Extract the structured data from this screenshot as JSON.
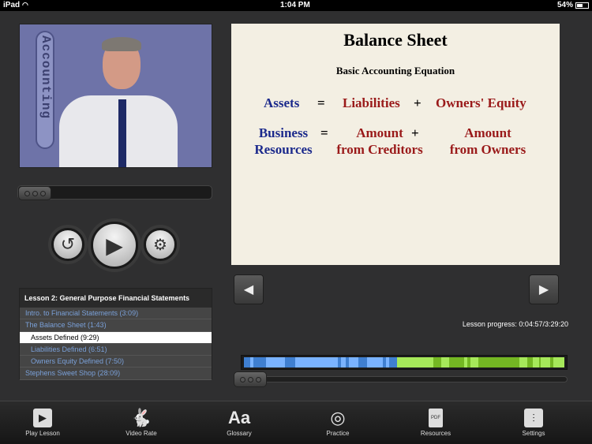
{
  "status": {
    "device": "iPad",
    "time": "1:04 PM",
    "battery": "54%"
  },
  "video": {
    "set_label": "Accounting"
  },
  "slide": {
    "title": "Balance Sheet",
    "subtitle": "Basic Accounting Equation",
    "row1": {
      "left": "Assets",
      "eq": "=",
      "mid": "Liabilities",
      "plus": "+",
      "right": "Owners' Equity"
    },
    "row2": {
      "left1": "Business",
      "left2": "Resources",
      "eq": "=",
      "mid1": "Amount",
      "mid2": "from Creditors",
      "plus": "+",
      "right1": "Amount",
      "right2": "from Owners"
    }
  },
  "playlist": {
    "title": "Lesson 2: General Purpose Financial Statements",
    "items": [
      "Intro. to Financial Statements (3:09)",
      "The Balance Sheet (1:43)",
      "Assets Defined (9:29)",
      "Liabilities Defined (6:51)",
      "Owners Equity Defined (7:50)",
      "Stephens Sweet Shop (28:09)"
    ],
    "selected_index": 2
  },
  "progress": {
    "text": "Lesson progress: 0:04:57/3:29:20",
    "fraction": 0.024
  },
  "colors": {
    "blue_light": "#7ab3ff",
    "blue_dark": "#3f7fd0",
    "green_light": "#a6e85a",
    "green_dark": "#74b723"
  },
  "tabs": [
    {
      "label": "Play Lesson",
      "icon": "play-icon"
    },
    {
      "label": "Video Rate",
      "icon": "rabbit-icon"
    },
    {
      "label": "Glossary",
      "icon": "glossary-icon"
    },
    {
      "label": "Practice",
      "icon": "target-icon"
    },
    {
      "label": "Resources",
      "icon": "pdf-icon"
    },
    {
      "label": "Settings",
      "icon": "sliders-icon"
    }
  ]
}
